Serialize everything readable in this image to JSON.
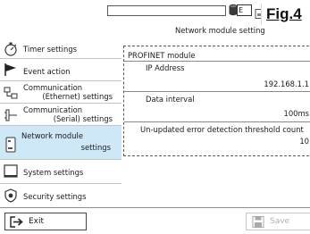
{
  "header": {
    "top_field_value": "",
    "device_selector_value": "E",
    "figure_label": "Fig.4",
    "page_title": "Network module setting"
  },
  "sidebar": {
    "items": [
      {
        "label_lines": [
          "Timer settings"
        ],
        "icon": "stopwatch-icon",
        "active": false
      },
      {
        "label_lines": [
          "Event action"
        ],
        "icon": "flag-icon",
        "active": false
      },
      {
        "label_lines": [
          "Communication",
          "(Ethernet) settings"
        ],
        "icon": "ethernet-icon",
        "active": false
      },
      {
        "label_lines": [
          "Communication",
          "(Serial) settings"
        ],
        "icon": "serial-icon",
        "active": false
      },
      {
        "label_lines": [
          "Network module",
          "settings"
        ],
        "icon": "network-module-icon",
        "active": true
      },
      {
        "label_lines": [
          "System settings"
        ],
        "icon": "monitor-icon",
        "active": false
      },
      {
        "label_lines": [
          "Security settings"
        ],
        "icon": "shield-icon",
        "active": false
      }
    ]
  },
  "main": {
    "module_title": "PROFINET module",
    "fields": [
      {
        "label": "IP Address",
        "value": "192.168.1.1"
      },
      {
        "label": "Data interval",
        "value": "100ms"
      },
      {
        "label": "Un-updated error detection threshold count",
        "value": "10"
      }
    ]
  },
  "footer": {
    "exit_label": "Exit",
    "save_label": "Save",
    "save_enabled": false
  },
  "colors": {
    "active_item_bg": "#cfe8f8",
    "border": "#b0b0b0",
    "disabled_text": "#b4b4b4"
  }
}
